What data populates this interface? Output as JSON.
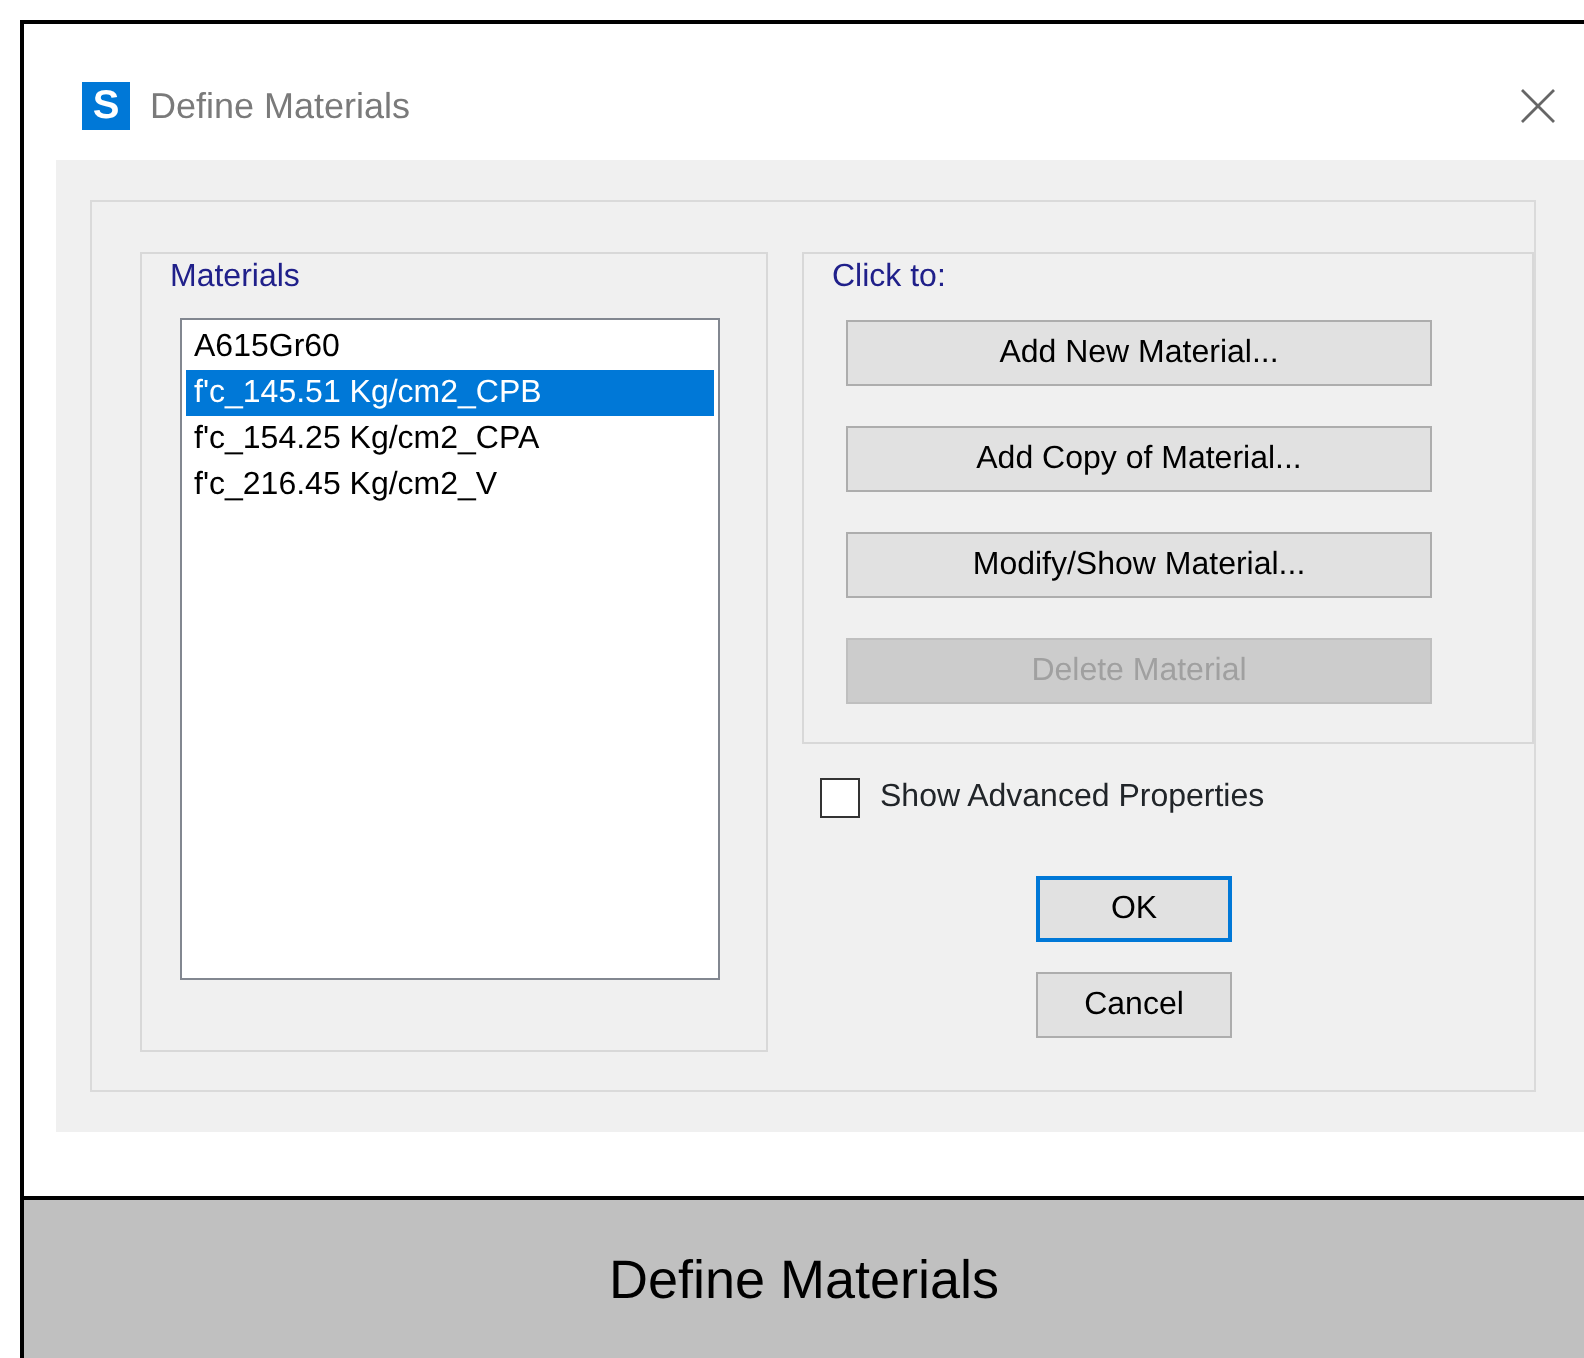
{
  "window": {
    "title": "Define Materials",
    "app_icon_letter": "S"
  },
  "materials": {
    "label": "Materials",
    "items": [
      {
        "name": "A615Gr60",
        "selected": false
      },
      {
        "name": "f'c_145.51 Kg/cm2_CPB",
        "selected": true
      },
      {
        "name": "f'c_154.25 Kg/cm2_CPA",
        "selected": false
      },
      {
        "name": "f'c_216.45 Kg/cm2_V",
        "selected": false
      }
    ]
  },
  "click_to": {
    "label": "Click to:",
    "buttons": [
      {
        "label": "Add New Material...",
        "disabled": false
      },
      {
        "label": "Add Copy of Material...",
        "disabled": false
      },
      {
        "label": "Modify/Show Material...",
        "disabled": false
      },
      {
        "label": "Delete Material",
        "disabled": true
      }
    ]
  },
  "show_advanced": {
    "label": "Show Advanced Properties",
    "checked": false
  },
  "dialog_buttons": [
    {
      "label": "OK",
      "default": true
    },
    {
      "label": "Cancel",
      "default": false
    }
  ],
  "caption": "Define Materials"
}
